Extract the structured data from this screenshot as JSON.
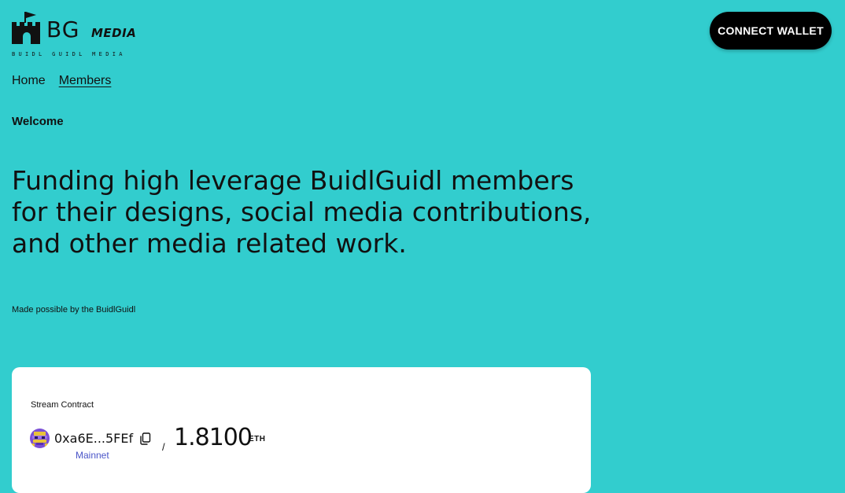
{
  "header": {
    "logo": {
      "title": "BG",
      "tag": "MEDIA",
      "subtitle": "BUIDL GUIDL MEDIA",
      "icon": "castle-icon"
    },
    "connect_label": "CONNECT WALLET"
  },
  "nav": {
    "items": [
      {
        "label": "Home"
      },
      {
        "label": "Members"
      }
    ],
    "active_index": 1
  },
  "welcome": "Welcome",
  "hero": {
    "text": "Funding high leverage BuidlGuidl members for their designs, social media contributions, and other media related work.",
    "subtext": "Made possible by the BuidlGuidl"
  },
  "stream": {
    "label": "Stream Contract",
    "address": "0xa6E...5FEf",
    "network": "Mainnet",
    "separator": "/",
    "balance": "1.8100",
    "unit": "ETH",
    "icons": [
      "avatar-icon",
      "copy-icon"
    ]
  },
  "colors": {
    "background": "#32cdce",
    "button": "#000000",
    "card": "#ffffff",
    "network": "#4a55c8"
  }
}
